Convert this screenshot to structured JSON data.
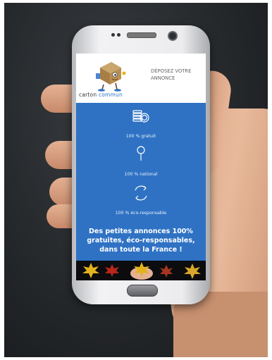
{
  "app": {
    "brand_part1": "carton ",
    "brand_part2": "commun",
    "cta_label": "DÉPOSEZ VOTRE ANNONCE"
  },
  "features": [
    {
      "label": "100 % gratuit",
      "icon": "coins-icon"
    },
    {
      "label": "100 % national",
      "icon": "location-pin-icon"
    },
    {
      "label": "100 % éco-responsable",
      "icon": "recycle-arrows-icon"
    }
  ],
  "tagline": "Des petites annonces 100% gratuites, éco-responsables, dans toute la France !",
  "colors": {
    "accent_blue": "#2f72c4",
    "leaf_yellow": "#e2b31c",
    "leaf_red": "#b8261b"
  }
}
